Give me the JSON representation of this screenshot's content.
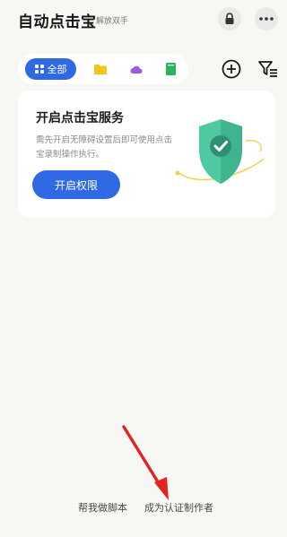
{
  "header": {
    "title": "自动点击宝",
    "subtitle": "解放双手"
  },
  "tabs": {
    "all_label": "全部",
    "items": [
      "folder-icon",
      "cloud-icon",
      "book-icon"
    ]
  },
  "service_card": {
    "title": "开启点击宝服务",
    "description": "需先开启无障碍设置后即可使用点击宝录制操作执行。",
    "button_label": "开启权限"
  },
  "footer": {
    "link_help": "帮我做脚本",
    "link_author": "成为认证制作者"
  },
  "colors": {
    "accent": "#2f6ae4",
    "shield": "#4fc9a2",
    "annotation_arrow": "#e32222"
  }
}
